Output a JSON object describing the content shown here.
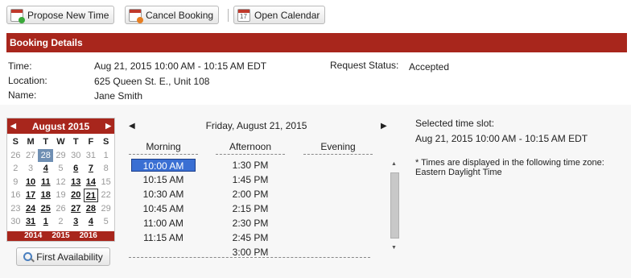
{
  "toolbar": {
    "propose_label": "Propose New Time",
    "cancel_label": "Cancel Booking",
    "open_label": "Open Calendar"
  },
  "section": {
    "title": "Booking Details"
  },
  "details": {
    "time_label": "Time:",
    "time_value": "Aug 21, 2015 10:00 AM - 10:15 AM EDT",
    "location_label": "Location:",
    "location_value": "625 Queen St. E., Unit 108",
    "name_label": "Name:",
    "name_value": "Jane Smith",
    "status_label": "Request Status:",
    "status_value": "Accepted"
  },
  "calendar": {
    "month_title": "August 2015",
    "weekdays": [
      "S",
      "M",
      "T",
      "W",
      "T",
      "F",
      "S"
    ],
    "days": [
      {
        "d": "26",
        "s": "other"
      },
      {
        "d": "27",
        "s": "other"
      },
      {
        "d": "28",
        "s": "today"
      },
      {
        "d": "29",
        "s": "other"
      },
      {
        "d": "30",
        "s": "other"
      },
      {
        "d": "31",
        "s": "other"
      },
      {
        "d": "1",
        "s": "other"
      },
      {
        "d": "2",
        "s": "muted"
      },
      {
        "d": "3",
        "s": "muted"
      },
      {
        "d": "4",
        "s": "avail"
      },
      {
        "d": "5",
        "s": "muted"
      },
      {
        "d": "6",
        "s": "avail"
      },
      {
        "d": "7",
        "s": "avail"
      },
      {
        "d": "8",
        "s": "muted"
      },
      {
        "d": "9",
        "s": "muted"
      },
      {
        "d": "10",
        "s": "avail"
      },
      {
        "d": "11",
        "s": "avail"
      },
      {
        "d": "12",
        "s": "muted"
      },
      {
        "d": "13",
        "s": "avail"
      },
      {
        "d": "14",
        "s": "avail"
      },
      {
        "d": "15",
        "s": "muted"
      },
      {
        "d": "16",
        "s": "muted"
      },
      {
        "d": "17",
        "s": "avail"
      },
      {
        "d": "18",
        "s": "avail"
      },
      {
        "d": "19",
        "s": "muted"
      },
      {
        "d": "20",
        "s": "avail"
      },
      {
        "d": "21",
        "s": "sel"
      },
      {
        "d": "22",
        "s": "muted"
      },
      {
        "d": "23",
        "s": "muted"
      },
      {
        "d": "24",
        "s": "avail"
      },
      {
        "d": "25",
        "s": "avail"
      },
      {
        "d": "26",
        "s": "muted"
      },
      {
        "d": "27",
        "s": "avail"
      },
      {
        "d": "28",
        "s": "avail"
      },
      {
        "d": "29",
        "s": "muted"
      },
      {
        "d": "30",
        "s": "muted"
      },
      {
        "d": "31",
        "s": "avail"
      },
      {
        "d": "1",
        "s": "avail"
      },
      {
        "d": "2",
        "s": "muted"
      },
      {
        "d": "3",
        "s": "avail"
      },
      {
        "d": "4",
        "s": "avail"
      },
      {
        "d": "5",
        "s": "muted"
      }
    ],
    "years": [
      "2014",
      "2015",
      "2016"
    ]
  },
  "first_availability_label": "First Availability",
  "day_view": {
    "title": "Friday, August 21, 2015",
    "morning_label": "Morning",
    "afternoon_label": "Afternoon",
    "evening_label": "Evening",
    "morning_slots": [
      "10:00 AM",
      "10:15 AM",
      "10:30 AM",
      "10:45 AM",
      "11:00 AM",
      "11:15 AM"
    ],
    "afternoon_slots": [
      "1:30 PM",
      "1:45 PM",
      "2:00 PM",
      "2:15 PM",
      "2:30 PM",
      "2:45 PM",
      "3:00 PM"
    ],
    "selected_slot": "10:00 AM"
  },
  "selected_info": {
    "label": "Selected time slot:",
    "value": "Aug 21, 2015 10:00 AM - 10:15 AM EDT",
    "tz_note_line1": "* Times are displayed in the following time zone:",
    "tz_note_line2": "Eastern Daylight Time"
  },
  "colors": {
    "accent": "#a8261c",
    "selected_slot": "#3a6fd3",
    "today_cell": "#6f8fb3"
  },
  "icons": {
    "propose": "calendar-add-icon",
    "cancel": "calendar-cancel-icon",
    "open": "calendar-icon",
    "search": "magnifier-icon"
  }
}
